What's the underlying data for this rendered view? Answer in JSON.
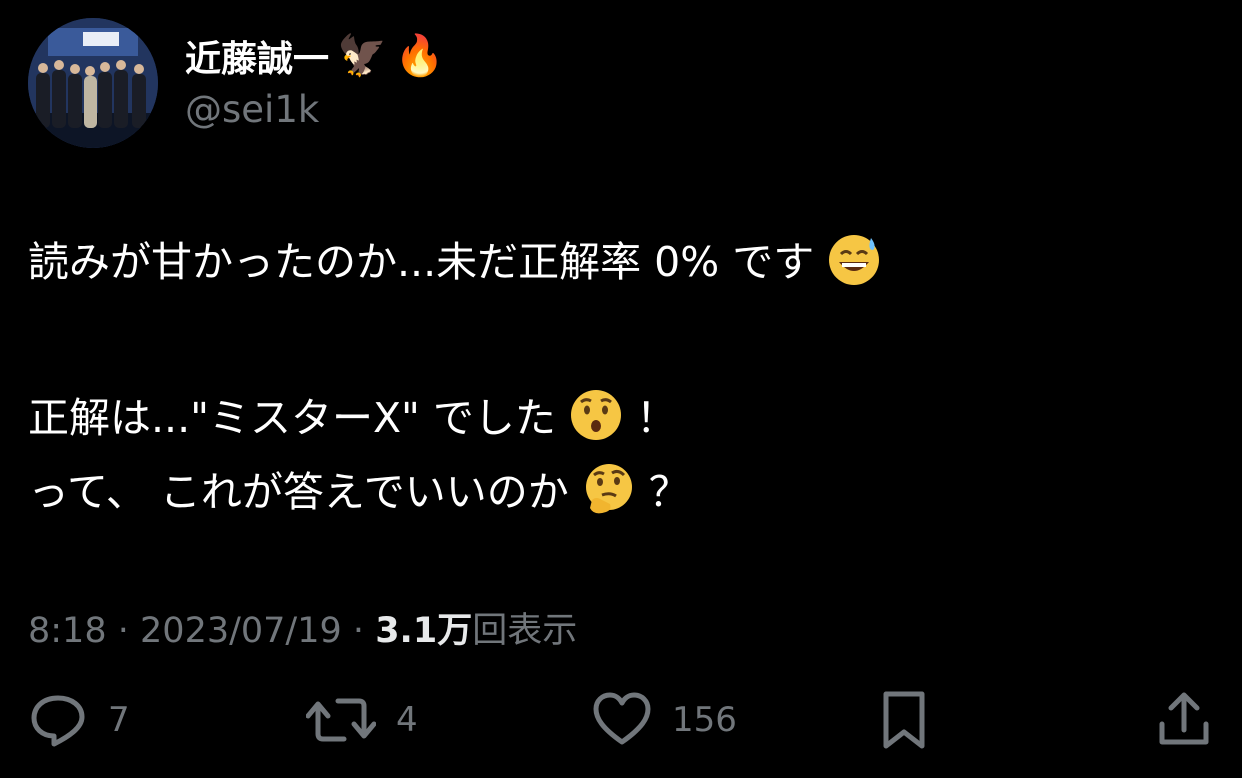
{
  "profile": {
    "name": "近藤誠一",
    "handle": "@sei1k",
    "name_emojis": [
      "🦅",
      "🔥"
    ]
  },
  "tweet": {
    "line1_text": "読みが甘かったのか...未だ正解率 0% です",
    "line1_emoji": "grinning-sweat-emoji",
    "line2_text": "正解は...\"ミスターX\" でした",
    "line2_emoji": "hushed-emoji",
    "line2_suffix": "！",
    "line3_text": "って、 これが答えでいいのか",
    "line3_emoji": "thinking-emoji",
    "line3_suffix": "？"
  },
  "meta": {
    "time": "8:18",
    "separator": "·",
    "date": "2023/07/19",
    "views_count": "3.1万",
    "views_label": "回表示"
  },
  "actions": {
    "reply_count": "7",
    "retweet_count": "4",
    "like_count": "156"
  },
  "colors": {
    "background": "#000000",
    "text": "#ffffff",
    "secondary": "#71767b"
  }
}
